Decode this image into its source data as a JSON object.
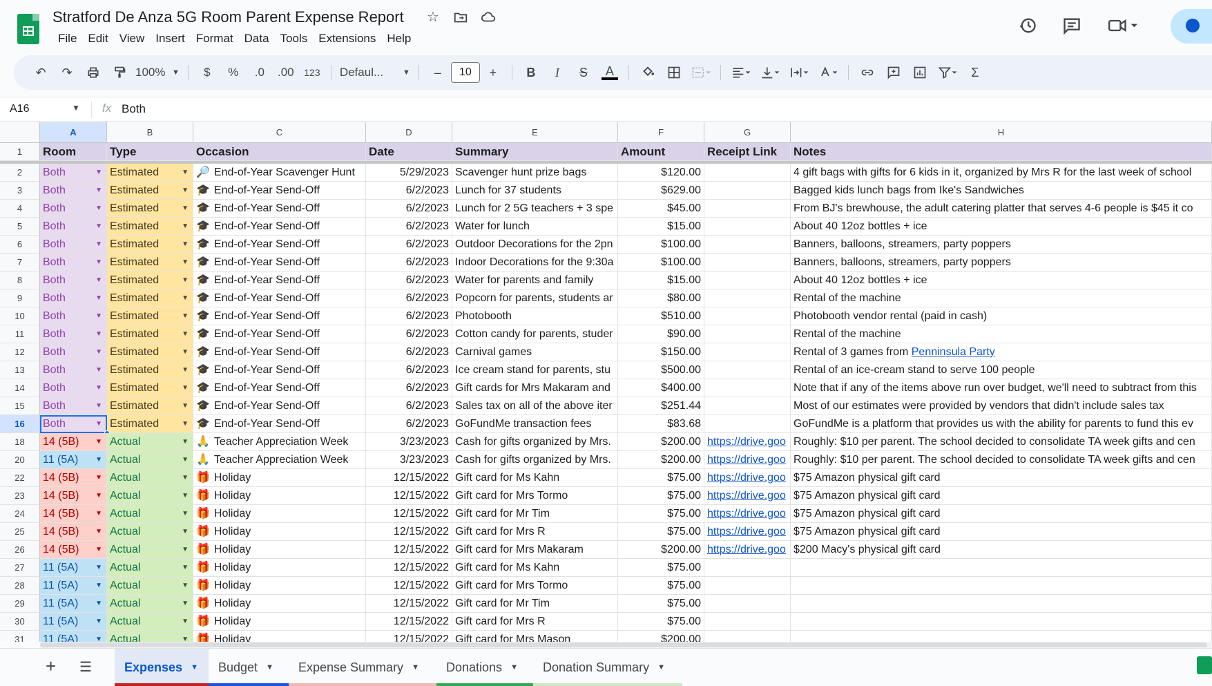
{
  "app": {
    "title": "Stratford De Anza 5G Room Parent Expense Report",
    "menu": [
      "File",
      "Edit",
      "View",
      "Insert",
      "Format",
      "Data",
      "Tools",
      "Extensions",
      "Help"
    ]
  },
  "toolbar": {
    "zoom": "100%",
    "currency": "$",
    "percent": "%",
    "dec_decrease": ".0",
    "dec_increase": ".00",
    "number_format": "123",
    "font": "Defaul...",
    "font_size": "10"
  },
  "formula_bar": {
    "cell_ref": "A16",
    "fx": "fx",
    "value": "Both"
  },
  "columns": [
    "A",
    "B",
    "C",
    "D",
    "E",
    "F",
    "G",
    "H"
  ],
  "header_row": {
    "num": "1",
    "cells": [
      "Room",
      "Type",
      "Occasion",
      "Date",
      "Summary",
      "Amount",
      "Receipt Link",
      "Notes"
    ]
  },
  "rows": [
    {
      "num": "2",
      "room": "Both",
      "type": "Estimated",
      "icon": "🔎",
      "occasion": "End-of-Year Scavenger Hunt",
      "date": "5/29/2023",
      "summary": "Scavenger hunt prize bags",
      "amount": "$120.00",
      "link": "",
      "notes": "4 gift bags with gifts for 6 kids in it, organized by Mrs R for the last week of school"
    },
    {
      "num": "3",
      "room": "Both",
      "type": "Estimated",
      "icon": "🎓",
      "occasion": "End-of-Year Send-Off",
      "date": "6/2/2023",
      "summary": "Lunch for 37 students",
      "amount": "$629.00",
      "link": "",
      "notes": "Bagged kids lunch bags from Ike's Sandwiches"
    },
    {
      "num": "4",
      "room": "Both",
      "type": "Estimated",
      "icon": "🎓",
      "occasion": "End-of-Year Send-Off",
      "date": "6/2/2023",
      "summary": "Lunch for 2 5G teachers + 3 spe",
      "amount": "$45.00",
      "link": "",
      "notes": "From BJ's brewhouse, the adult catering platter that serves 4-6 people is $45 it co"
    },
    {
      "num": "5",
      "room": "Both",
      "type": "Estimated",
      "icon": "🎓",
      "occasion": "End-of-Year Send-Off",
      "date": "6/2/2023",
      "summary": "Water for lunch",
      "amount": "$15.00",
      "link": "",
      "notes": "About 40 12oz bottles + ice"
    },
    {
      "num": "6",
      "room": "Both",
      "type": "Estimated",
      "icon": "🎓",
      "occasion": "End-of-Year Send-Off",
      "date": "6/2/2023",
      "summary": "Outdoor Decorations for the 2pn",
      "amount": "$100.00",
      "link": "",
      "notes": "Banners, balloons, streamers, party poppers"
    },
    {
      "num": "7",
      "room": "Both",
      "type": "Estimated",
      "icon": "🎓",
      "occasion": "End-of-Year Send-Off",
      "date": "6/2/2023",
      "summary": "Indoor Decorations for the 9:30a",
      "amount": "$100.00",
      "link": "",
      "notes": "Banners, balloons, streamers, party poppers"
    },
    {
      "num": "8",
      "room": "Both",
      "type": "Estimated",
      "icon": "🎓",
      "occasion": "End-of-Year Send-Off",
      "date": "6/2/2023",
      "summary": "Water for parents and family",
      "amount": "$15.00",
      "link": "",
      "notes": "About 40 12oz bottles + ice"
    },
    {
      "num": "9",
      "room": "Both",
      "type": "Estimated",
      "icon": "🎓",
      "occasion": "End-of-Year Send-Off",
      "date": "6/2/2023",
      "summary": "Popcorn for parents, students ar",
      "amount": "$80.00",
      "link": "",
      "notes": "Rental of the machine"
    },
    {
      "num": "10",
      "room": "Both",
      "type": "Estimated",
      "icon": "🎓",
      "occasion": "End-of-Year Send-Off",
      "date": "6/2/2023",
      "summary": "Photobooth",
      "amount": "$510.00",
      "link": "",
      "notes": "Photobooth vendor rental (paid in cash)"
    },
    {
      "num": "11",
      "room": "Both",
      "type": "Estimated",
      "icon": "🎓",
      "occasion": "End-of-Year Send-Off",
      "date": "6/2/2023",
      "summary": "Cotton candy for parents, studer",
      "amount": "$90.00",
      "link": "",
      "notes": "Rental of the machine"
    },
    {
      "num": "12",
      "room": "Both",
      "type": "Estimated",
      "icon": "🎓",
      "occasion": "End-of-Year Send-Off",
      "date": "6/2/2023",
      "summary": "Carnival games",
      "amount": "$150.00",
      "link": "",
      "notes": "Rental of 3 games from ",
      "notes_link": "Penninsula Party"
    },
    {
      "num": "13",
      "room": "Both",
      "type": "Estimated",
      "icon": "🎓",
      "occasion": "End-of-Year Send-Off",
      "date": "6/2/2023",
      "summary": "Ice cream stand for parents, stu",
      "amount": "$500.00",
      "link": "",
      "notes": "Rental of an ice-cream stand to serve 100 people"
    },
    {
      "num": "14",
      "room": "Both",
      "type": "Estimated",
      "icon": "🎓",
      "occasion": "End-of-Year Send-Off",
      "date": "6/2/2023",
      "summary": "Gift cards for Mrs Makaram and",
      "amount": "$400.00",
      "link": "",
      "notes": "Note that if any of the items above run over budget, we'll need to subtract from this"
    },
    {
      "num": "15",
      "room": "Both",
      "type": "Estimated",
      "icon": "🎓",
      "occasion": "End-of-Year Send-Off",
      "date": "6/2/2023",
      "summary": "Sales tax on all of the above iter",
      "amount": "$251.44",
      "link": "",
      "notes": "Most of our estimates were provided by vendors that didn't include sales tax"
    },
    {
      "num": "16",
      "room": "Both",
      "type": "Estimated",
      "icon": "🎓",
      "occasion": "End-of-Year Send-Off",
      "date": "6/2/2023",
      "summary": "GoFundMe transaction fees",
      "amount": "$83.68",
      "link": "",
      "notes": "GoFundMe is a platform that provides us with the ability for parents to fund this ev"
    },
    {
      "num": "18",
      "room": "14 (5B)",
      "type": "Actual",
      "icon": "🙏",
      "occasion": "Teacher Appreciation Week",
      "date": "3/23/2023",
      "summary": "Cash for gifts organized by Mrs.",
      "amount": "$200.00",
      "link": "https://drive.goo",
      "notes": "Roughly: $10 per parent. The school decided to consolidate TA week gifts and cen"
    },
    {
      "num": "20",
      "room": "11 (5A)",
      "type": "Actual",
      "icon": "🙏",
      "occasion": "Teacher Appreciation Week",
      "date": "3/23/2023",
      "summary": "Cash for gifts organized by Mrs.",
      "amount": "$200.00",
      "link": "https://drive.goo",
      "notes": "Roughly: $10 per parent. The school decided to consolidate TA week gifts and cen"
    },
    {
      "num": "22",
      "room": "14 (5B)",
      "type": "Actual",
      "icon": "🎁",
      "occasion": "Holiday",
      "date": "12/15/2022",
      "summary": "Gift card for Ms Kahn",
      "amount": "$75.00",
      "link": "https://drive.goo",
      "notes": "$75 Amazon physical gift card"
    },
    {
      "num": "23",
      "room": "14 (5B)",
      "type": "Actual",
      "icon": "🎁",
      "occasion": "Holiday",
      "date": "12/15/2022",
      "summary": "Gift card for Mrs Tormo",
      "amount": "$75.00",
      "link": "https://drive.goo",
      "notes": "$75 Amazon physical gift card"
    },
    {
      "num": "24",
      "room": "14 (5B)",
      "type": "Actual",
      "icon": "🎁",
      "occasion": "Holiday",
      "date": "12/15/2022",
      "summary": "Gift card for Mr Tim",
      "amount": "$75.00",
      "link": "https://drive.goo",
      "notes": "$75 Amazon physical gift card"
    },
    {
      "num": "25",
      "room": "14 (5B)",
      "type": "Actual",
      "icon": "🎁",
      "occasion": "Holiday",
      "date": "12/15/2022",
      "summary": "Gift card for Mrs R",
      "amount": "$75.00",
      "link": "https://drive.goo",
      "notes": "$75 Amazon physical gift card"
    },
    {
      "num": "26",
      "room": "14 (5B)",
      "type": "Actual",
      "icon": "🎁",
      "occasion": "Holiday",
      "date": "12/15/2022",
      "summary": "Gift card for Mrs Makaram",
      "amount": "$200.00",
      "link": "https://drive.goo",
      "notes": "$200 Macy's physical gift card"
    },
    {
      "num": "27",
      "room": "11 (5A)",
      "type": "Actual",
      "icon": "🎁",
      "occasion": "Holiday",
      "date": "12/15/2022",
      "summary": "Gift card for Ms Kahn",
      "amount": "$75.00",
      "link": "",
      "notes": ""
    },
    {
      "num": "28",
      "room": "11 (5A)",
      "type": "Actual",
      "icon": "🎁",
      "occasion": "Holiday",
      "date": "12/15/2022",
      "summary": "Gift card for Mrs Tormo",
      "amount": "$75.00",
      "link": "",
      "notes": ""
    },
    {
      "num": "29",
      "room": "11 (5A)",
      "type": "Actual",
      "icon": "🎁",
      "occasion": "Holiday",
      "date": "12/15/2022",
      "summary": "Gift card for Mr Tim",
      "amount": "$75.00",
      "link": "",
      "notes": ""
    },
    {
      "num": "30",
      "room": "11 (5A)",
      "type": "Actual",
      "icon": "🎁",
      "occasion": "Holiday",
      "date": "12/15/2022",
      "summary": "Gift card for Mrs R",
      "amount": "$75.00",
      "link": "",
      "notes": ""
    },
    {
      "num": "31",
      "room": "11 (5A)",
      "type": "Actual",
      "icon": "🎁",
      "occasion": "Holiday",
      "date": "12/15/2022",
      "summary": "Gift card for Mrs Mason",
      "amount": "$200.00",
      "link": "",
      "notes": ""
    }
  ],
  "tabs": [
    {
      "label": "Expenses",
      "color": "#c5221f",
      "active": true
    },
    {
      "label": "Budget",
      "color": "#1a56db",
      "active": false
    },
    {
      "label": "Expense Summary",
      "color": "#f4b6b2",
      "active": false
    },
    {
      "label": "Donations",
      "color": "#34a853",
      "active": false
    },
    {
      "label": "Donation Summary",
      "color": "#cce8c4",
      "active": false
    }
  ]
}
